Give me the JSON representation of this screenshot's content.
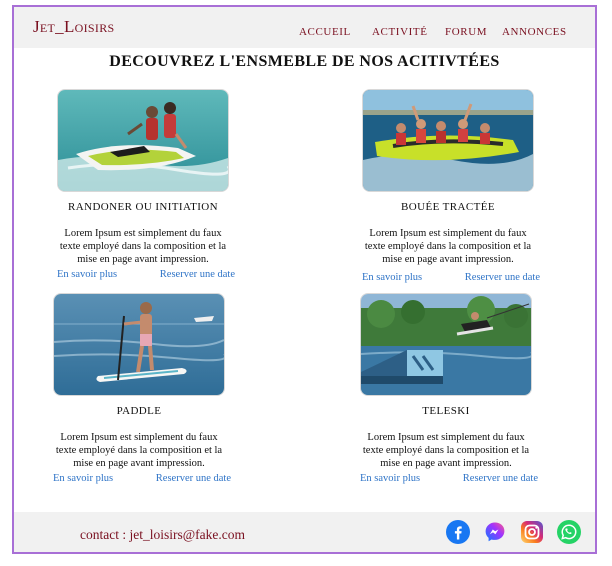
{
  "header": {
    "logo": "Jet_Loisirs",
    "nav": [
      "Accueil",
      "Activité",
      "Forum",
      "Annonces"
    ]
  },
  "page_title": "Decouvrez l'ensmeble de nos acitivtées",
  "cards": [
    {
      "title": "Randoner ou initiation",
      "description": "Lorem Ipsum est simplement du faux texte employé dans la composition et la mise en page avant impression.",
      "more_label": "En savoir plus",
      "book_label": "Reserver une date"
    },
    {
      "title": "Bouée tractée",
      "description": "Lorem Ipsum est simplement du faux texte employé dans la composition et la mise en page avant impression.",
      "more_label": "En savoir plus",
      "book_label": "Reserver une date"
    },
    {
      "title": "Paddle",
      "description": "Lorem Ipsum est simplement du faux texte employé dans la composition et la mise en page avant impression.",
      "more_label": "En savoir plus",
      "book_label": "Reserver une date"
    },
    {
      "title": "Teleski",
      "description": "Lorem Ipsum est simplement du faux texte employé dans la composition et la mise en page avant impression.",
      "more_label": "En savoir plus",
      "book_label": "Reserver une date"
    }
  ],
  "footer": {
    "contact": "contact : jet_loisirs@fake.com",
    "social_icons": [
      "facebook-icon",
      "messenger-icon",
      "instagram-icon",
      "whatsapp-icon"
    ]
  },
  "colors": {
    "brand": "#7a1020",
    "link": "#2f74c7",
    "frame_border": "#a86fd6",
    "bar_background": "#f1f1f1"
  }
}
